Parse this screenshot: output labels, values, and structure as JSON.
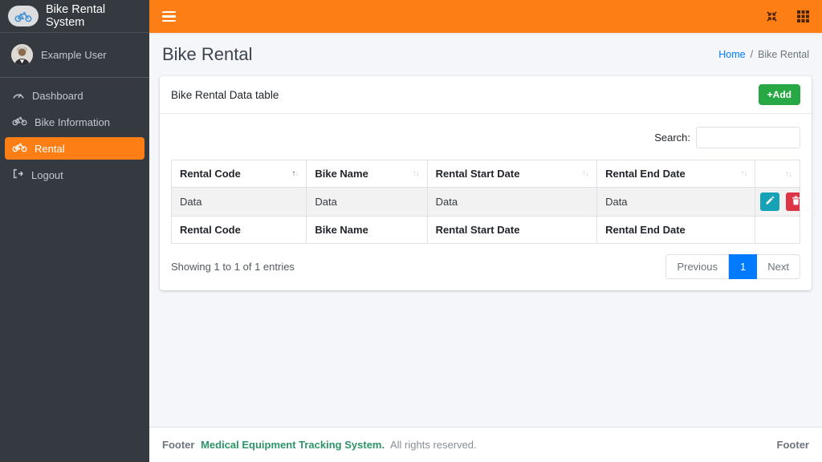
{
  "app": {
    "brand": "Bike Rental System",
    "user": "Example User"
  },
  "colors": {
    "navbar_orange": "#fd7e14",
    "sidebar_dark": "#343a40",
    "active_item_orange": "#fd7e14",
    "add_button_green": "#28a745",
    "edit_button_teal": "#17a2b8",
    "delete_button_red": "#dc3545",
    "link_blue": "#007bff",
    "pagination_active_blue": "#007bff",
    "footer_link_green": "#2d9467"
  },
  "sidebar": {
    "items": [
      {
        "label": "Dashboard",
        "icon": "tachometer-icon"
      },
      {
        "label": "Bike Information",
        "icon": "bicycle-icon"
      },
      {
        "label": "Rental",
        "icon": "bicycle-icon",
        "active": true
      },
      {
        "label": "Logout",
        "icon": "sign-out-icon"
      }
    ]
  },
  "header": {
    "title": "Bike Rental",
    "breadcrumb": {
      "home": "Home",
      "separator": "/",
      "current": "Bike Rental"
    }
  },
  "card": {
    "title": "Bike Rental Data table",
    "add_label": "+Add",
    "search_label": "Search:",
    "search_value": ""
  },
  "icons": {
    "sort_up": "↑",
    "sort_down": "↓"
  },
  "table": {
    "columns": [
      "Rental Code",
      "Bike Name",
      "Rental Start Date",
      "Rental End Date",
      ""
    ],
    "rows": [
      [
        "Data",
        "Data",
        "Data",
        "Data"
      ]
    ],
    "footer_columns": [
      "Rental Code",
      "Bike Name",
      "Rental Start Date",
      "Rental End Date",
      ""
    ],
    "info": "Showing 1 to 1 of 1 entries",
    "pagination": {
      "previous": "Previous",
      "page": "1",
      "next": "Next"
    }
  },
  "footer": {
    "prefix": "Footer",
    "link": "Medical Equipment Tracking System.",
    "suffix": "All rights reserved.",
    "right": "Footer"
  }
}
